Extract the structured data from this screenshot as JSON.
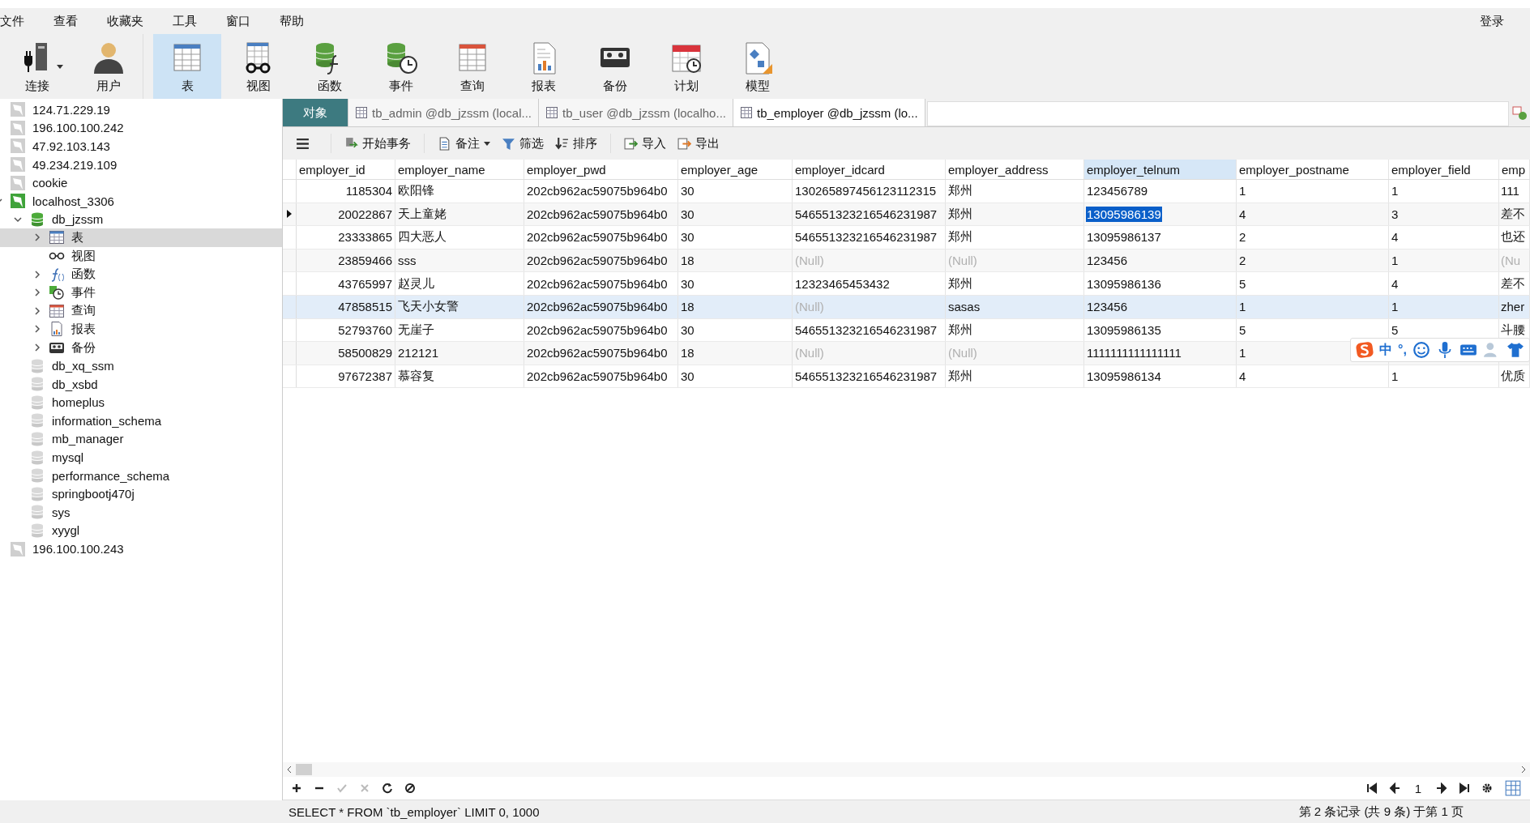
{
  "menu": [
    "文件",
    "查看",
    "收藏夹",
    "工具",
    "窗口",
    "帮助"
  ],
  "login": "登录",
  "toolbar": [
    {
      "label": "连接",
      "kind": "connection",
      "selected": false
    },
    {
      "label": "用户",
      "kind": "user",
      "selected": false
    },
    {
      "label": "表",
      "kind": "table",
      "selected": true
    },
    {
      "label": "视图",
      "kind": "view",
      "selected": false
    },
    {
      "label": "函数",
      "kind": "function",
      "selected": false
    },
    {
      "label": "事件",
      "kind": "event",
      "selected": false
    },
    {
      "label": "查询",
      "kind": "query",
      "selected": false
    },
    {
      "label": "报表",
      "kind": "report",
      "selected": false
    },
    {
      "label": "备份",
      "kind": "backup",
      "selected": false
    },
    {
      "label": "计划",
      "kind": "schedule",
      "selected": false
    },
    {
      "label": "模型",
      "kind": "model",
      "selected": false
    }
  ],
  "tree": [
    {
      "label": "124.71.229.19",
      "kind": "connection",
      "connected": false,
      "selected": false
    },
    {
      "label": "196.100.100.242",
      "kind": "connection",
      "connected": false,
      "selected": false
    },
    {
      "label": "47.92.103.143",
      "kind": "connection",
      "connected": false,
      "selected": false
    },
    {
      "label": "49.234.219.109",
      "kind": "connection",
      "connected": false,
      "selected": false
    },
    {
      "label": "cookie",
      "kind": "connection",
      "connected": false,
      "selected": false
    },
    {
      "label": "localhost_3306",
      "kind": "connection",
      "connected": true,
      "selected": false,
      "expanded": true,
      "children": [
        {
          "label": "db_jzssm",
          "kind": "database",
          "connected": true,
          "selected": false,
          "expanded": true,
          "children": [
            {
              "label": "表",
              "kind": "table",
              "selected": true,
              "expanded": false
            },
            {
              "label": "视图",
              "kind": "view",
              "selected": false
            },
            {
              "label": "函数",
              "kind": "function",
              "selected": false,
              "expanded": false
            },
            {
              "label": "事件",
              "kind": "event",
              "selected": false,
              "expanded": false
            },
            {
              "label": "查询",
              "kind": "query",
              "selected": false,
              "expanded": false
            },
            {
              "label": "报表",
              "kind": "report",
              "selected": false,
              "expanded": false
            },
            {
              "label": "备份",
              "kind": "backup",
              "selected": false,
              "expanded": false
            }
          ]
        },
        {
          "label": "db_xq_ssm",
          "kind": "database",
          "connected": false,
          "selected": false
        },
        {
          "label": "db_xsbd",
          "kind": "database",
          "connected": false,
          "selected": false
        },
        {
          "label": "homeplus",
          "kind": "database",
          "connected": false,
          "selected": false
        },
        {
          "label": "information_schema",
          "kind": "database",
          "connected": false,
          "selected": false
        },
        {
          "label": "mb_manager",
          "kind": "database",
          "connected": false,
          "selected": false
        },
        {
          "label": "mysql",
          "kind": "database",
          "connected": false,
          "selected": false
        },
        {
          "label": "performance_schema",
          "kind": "database",
          "connected": false,
          "selected": false
        },
        {
          "label": "springbootj470j",
          "kind": "database",
          "connected": false,
          "selected": false
        },
        {
          "label": "sys",
          "kind": "database",
          "connected": false,
          "selected": false
        },
        {
          "label": "xyygl",
          "kind": "database",
          "connected": false,
          "selected": false
        }
      ]
    },
    {
      "label": "196.100.100.243",
      "kind": "connection",
      "connected": false,
      "selected": false
    }
  ],
  "tabs": [
    {
      "label": "对象",
      "kind": "objects",
      "selected": false
    },
    {
      "label": "tb_admin @db_jzssm (local...",
      "kind": "table",
      "selected": false
    },
    {
      "label": "tb_user @db_jzssm (localho...",
      "kind": "table",
      "selected": false
    },
    {
      "label": "tb_employer @db_jzssm (lo...",
      "kind": "table",
      "selected": true
    }
  ],
  "data_toolbar": [
    {
      "label": "开始事务",
      "kind": "transaction",
      "dropdown": false
    },
    {
      "label": "备注",
      "kind": "note",
      "dropdown": true
    },
    {
      "label": "筛选",
      "kind": "filter",
      "dropdown": false
    },
    {
      "label": "排序",
      "kind": "sort",
      "dropdown": false
    },
    {
      "label": "导入",
      "kind": "import",
      "dropdown": false
    },
    {
      "label": "导出",
      "kind": "export",
      "dropdown": false
    }
  ],
  "columns": [
    {
      "name": "employer_id",
      "selected": false
    },
    {
      "name": "employer_name",
      "selected": false
    },
    {
      "name": "employer_pwd",
      "selected": false
    },
    {
      "name": "employer_age",
      "selected": false
    },
    {
      "name": "employer_idcard",
      "selected": false
    },
    {
      "name": "employer_address",
      "selected": false
    },
    {
      "name": "employer_telnum",
      "selected": true
    },
    {
      "name": "employer_postname",
      "selected": false
    },
    {
      "name": "employer_field",
      "selected": false
    },
    {
      "name": "emp",
      "selected": false
    }
  ],
  "rows": [
    {
      "selected": false,
      "hovered": false,
      "cells": [
        "1185304",
        "欧阳锋",
        "202cb962ac59075b964b0",
        "30",
        "130265897456123112315",
        "郑州",
        "123456789",
        "1",
        "1",
        "111"
      ]
    },
    {
      "selected": true,
      "hovered": false,
      "cells": [
        "20022867",
        "天上童姥",
        "202cb962ac59075b964b0",
        "30",
        "546551323216546231987",
        "郑州",
        "13095986139",
        "4",
        "3",
        "差不"
      ]
    },
    {
      "selected": false,
      "hovered": false,
      "cells": [
        "23333865",
        "四大恶人",
        "202cb962ac59075b964b0",
        "30",
        "546551323216546231987",
        "郑州",
        "13095986137",
        "2",
        "4",
        "也还"
      ]
    },
    {
      "selected": false,
      "hovered": false,
      "cells": [
        "23859466",
        "sss",
        "202cb962ac59075b964b0",
        "18",
        {
          "text": "(Null)",
          "null": true
        },
        {
          "text": "(Null)",
          "null": true
        },
        "123456",
        "2",
        "1",
        {
          "text": "(Nu",
          "null": true
        }
      ]
    },
    {
      "selected": false,
      "hovered": false,
      "cells": [
        "43765997",
        "赵灵儿",
        "202cb962ac59075b964b0",
        "30",
        "12323465453432",
        "郑州",
        "13095986136",
        "5",
        "4",
        "差不"
      ]
    },
    {
      "selected": false,
      "hovered": true,
      "cells": [
        "47858515",
        "飞天小女警",
        "202cb962ac59075b964b0",
        "18",
        {
          "text": "(Null)",
          "null": true
        },
        "sasas",
        "123456",
        "1",
        "1",
        "zher"
      ]
    },
    {
      "selected": false,
      "hovered": false,
      "cells": [
        "52793760",
        "无崖子",
        "202cb962ac59075b964b0",
        "30",
        "546551323216546231987",
        "郑州",
        "13095986135",
        "5",
        "5",
        "斗腰"
      ]
    },
    {
      "selected": false,
      "hovered": false,
      "cells": [
        "58500829",
        "212121",
        "202cb962ac59075b964b0",
        "18",
        {
          "text": "(Null)",
          "null": true
        },
        {
          "text": "(Null)",
          "null": true
        },
        "1111111111111111",
        "1",
        null,
        null
      ]
    },
    {
      "selected": false,
      "hovered": false,
      "cells": [
        "97672387",
        "慕容复",
        "202cb962ac59075b964b0",
        "30",
        "546551323216546231987",
        "郑州",
        "13095986134",
        "4",
        "1",
        "优质"
      ]
    }
  ],
  "ime": {
    "mode": "中",
    "punctuation": "°,"
  },
  "page": "1",
  "status_bar": {
    "sql": "SELECT * FROM `tb_employer` LIMIT 0, 1000",
    "record": "第 2 条记录 (共 9 条) 于第 1 页"
  }
}
